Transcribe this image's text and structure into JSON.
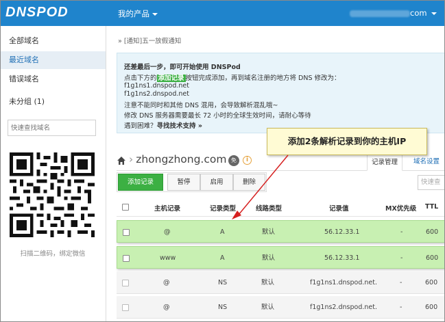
{
  "header": {
    "logo": "DNSPOD",
    "my_products": "我的产品",
    "account_suffix": "com"
  },
  "sidebar": {
    "items": [
      {
        "label": "全部域名"
      },
      {
        "label": "最近域名"
      },
      {
        "label": "错误域名"
      },
      {
        "label": "未分组 (1)"
      }
    ],
    "search_placeholder": "快速查找域名",
    "qr_caption": "扫描二维码，绑定微信"
  },
  "breadcrumb": "» [通知]五一放假通知",
  "notice": {
    "title": "还差最后一步，即可开始使用 DNSPod",
    "line1_pre": "点击下方的",
    "line1_highlight": "添加记录",
    "line1_post": "按钮完成添加，再到域名注册的地方将 DNS 修改为：",
    "ns1": "f1g1ns1.dnspod.net",
    "ns2": "f1g1ns2.dnspod.net",
    "line4": "注意不能同时和其他 DNS 混用，会导致解析混乱哦~",
    "line5": "修改 DNS 服务器需要最长 72 小时的全球生效时间，请耐心等待",
    "line6_pre": "遇到困难？",
    "line6_link": "寻找技术支持 »"
  },
  "callout": "添加2条解析记录到你的主机IP",
  "domain": {
    "name": "zhongzhong.com",
    "badge": "免"
  },
  "tabs": {
    "records": "记录管理",
    "settings": "域名设置"
  },
  "toolbar": {
    "add": "添加记录",
    "pause": "暂停",
    "enable": "启用",
    "delete": "删除",
    "search_placeholder": "快速查"
  },
  "table": {
    "headers": {
      "host": "主机记录",
      "type": "记录类型",
      "line": "线路类型",
      "value": "记录值",
      "mx": "MX优先级",
      "ttl": "TTL"
    },
    "rows": [
      {
        "host": "@",
        "type": "A",
        "line": "默认",
        "value": "56.12.33.1",
        "mx": "-",
        "ttl": "600",
        "highlight": true
      },
      {
        "host": "www",
        "type": "A",
        "line": "默认",
        "value": "56.12.33.1",
        "mx": "-",
        "ttl": "600",
        "highlight": true
      },
      {
        "host": "@",
        "type": "NS",
        "line": "默认",
        "value": "f1g1ns1.dnspod.net.",
        "mx": "-",
        "ttl": "600",
        "highlight": false
      },
      {
        "host": "@",
        "type": "NS",
        "line": "默认",
        "value": "f1g1ns2.dnspod.net.",
        "mx": "-",
        "ttl": "600",
        "highlight": false
      }
    ]
  },
  "colors": {
    "brand_blue": "#1f84cc",
    "green_button": "#3cb043",
    "highlight_row": "#c8f0b2",
    "arrow_red": "#d62020"
  }
}
